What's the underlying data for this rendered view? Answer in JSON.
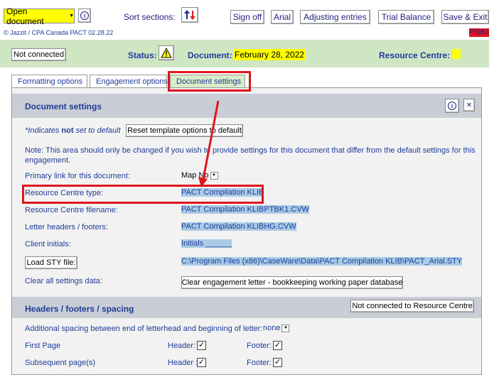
{
  "toolbar": {
    "document_menu": "Open document",
    "sort_sections": "Sort sections:",
    "sign_off": "Sign off",
    "font": "Arial",
    "adjusting_entries": "Adjusting entries",
    "trial_balance": "Trial Balance",
    "save_exit": "Save & Exit"
  },
  "copyright": "© Jazzit / CPA Canada PACT 02.28.22",
  "doc_code": "PTBK1",
  "status_bar": {
    "connection": "Not connected",
    "status_label": "Status:",
    "document_label": "Document:",
    "document_date": "February 28, 2022",
    "resource_centre_label": "Resource Centre:"
  },
  "tabs": [
    "Formatting options",
    "Engagement options",
    "Document settings"
  ],
  "document_settings": {
    "title": "Document settings",
    "default_note_prefix": "*Indicates ",
    "default_note_bold": "not",
    "default_note_suffix": " set to default",
    "reset_button": "Reset template options to default",
    "note": "Note: This area should only be changed if you wish to provide settings for this document that differ from the default settings for this engagement.",
    "rows": {
      "primary_link": {
        "label": "Primary link for this document:",
        "value": "Map No"
      },
      "rc_type": {
        "label": "Resource Centre type:",
        "value": "PACT Compilation KLIB"
      },
      "rc_filename": {
        "label": "Resource Centre filename:",
        "value": "PACT Compilation KLIBPTBK1.CVW"
      },
      "letter_headers": {
        "label": "Letter headers / footers:",
        "value": "PACT Compilation KLIBHG.CVW"
      },
      "client_initials": {
        "label": "Client initials:",
        "value": "Initials ______"
      },
      "load_sty": {
        "button": "Load STY file:",
        "value": "C:\\Program Files (x86)\\CaseWare\\Data\\PACT Compilation KLIB\\PACT_Arial.STY"
      },
      "clear_all": {
        "label": "Clear all settings data:",
        "button": "Clear engagement letter - bookkeeping working paper database"
      }
    }
  },
  "headers_footers": {
    "title": "Headers / footers / spacing",
    "rc_button": "Not connected to Resource Centre",
    "spacing_label": "Additional spacing between end of letterhead and beginning of letter:",
    "spacing_value": "none",
    "first_page": "First Page",
    "subsequent_page": "Subsequent page(s)",
    "header_label": "Header:",
    "header_label_2": "Header :",
    "footer_label": "Footer:"
  },
  "colors": {
    "status_bar_bg": "#cfe6c3",
    "panel_bg": "#f2f2f2",
    "section_bar_bg": "#c9cdd6",
    "highlight": "#ffff00",
    "selection": "#a9cbe6",
    "annotation_red": "#e0151f",
    "label_blue": "#1f3c99"
  }
}
